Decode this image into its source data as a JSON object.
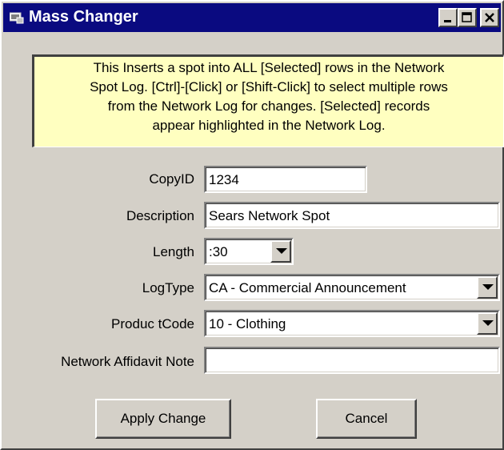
{
  "window": {
    "title": "Mass Changer",
    "icon": "app-icon",
    "controls": [
      "minimize-icon",
      "maximize-icon",
      "close-icon"
    ]
  },
  "info_text": "This Inserts a spot into ALL [Selected] rows in the Network\nSpot Log.   [Ctrl]-[Click] or [Shift-Click] to select multiple rows\nfrom the Network Log  for changes.   [Selected] records\nappear highlighted in the Network Log.",
  "form": {
    "copyid_label": "CopyID",
    "copyid_value": "1234",
    "description_label": "Description",
    "description_value": "Sears Network Spot",
    "length_label": "Length",
    "length_value": ":30",
    "logtype_label": "LogType",
    "logtype_value": "CA - Commercial Announcement",
    "productcode_label": "Produc tCode",
    "productcode_value": "10 - Clothing",
    "affidavit_label": "Network Affidavit Note",
    "affidavit_value": ""
  },
  "buttons": {
    "apply_label": "Apply Change",
    "cancel_label": "Cancel"
  },
  "colors": {
    "titlebar": "#0a0a80",
    "face": "#d4d0c8",
    "info_background": "#ffffc0"
  }
}
